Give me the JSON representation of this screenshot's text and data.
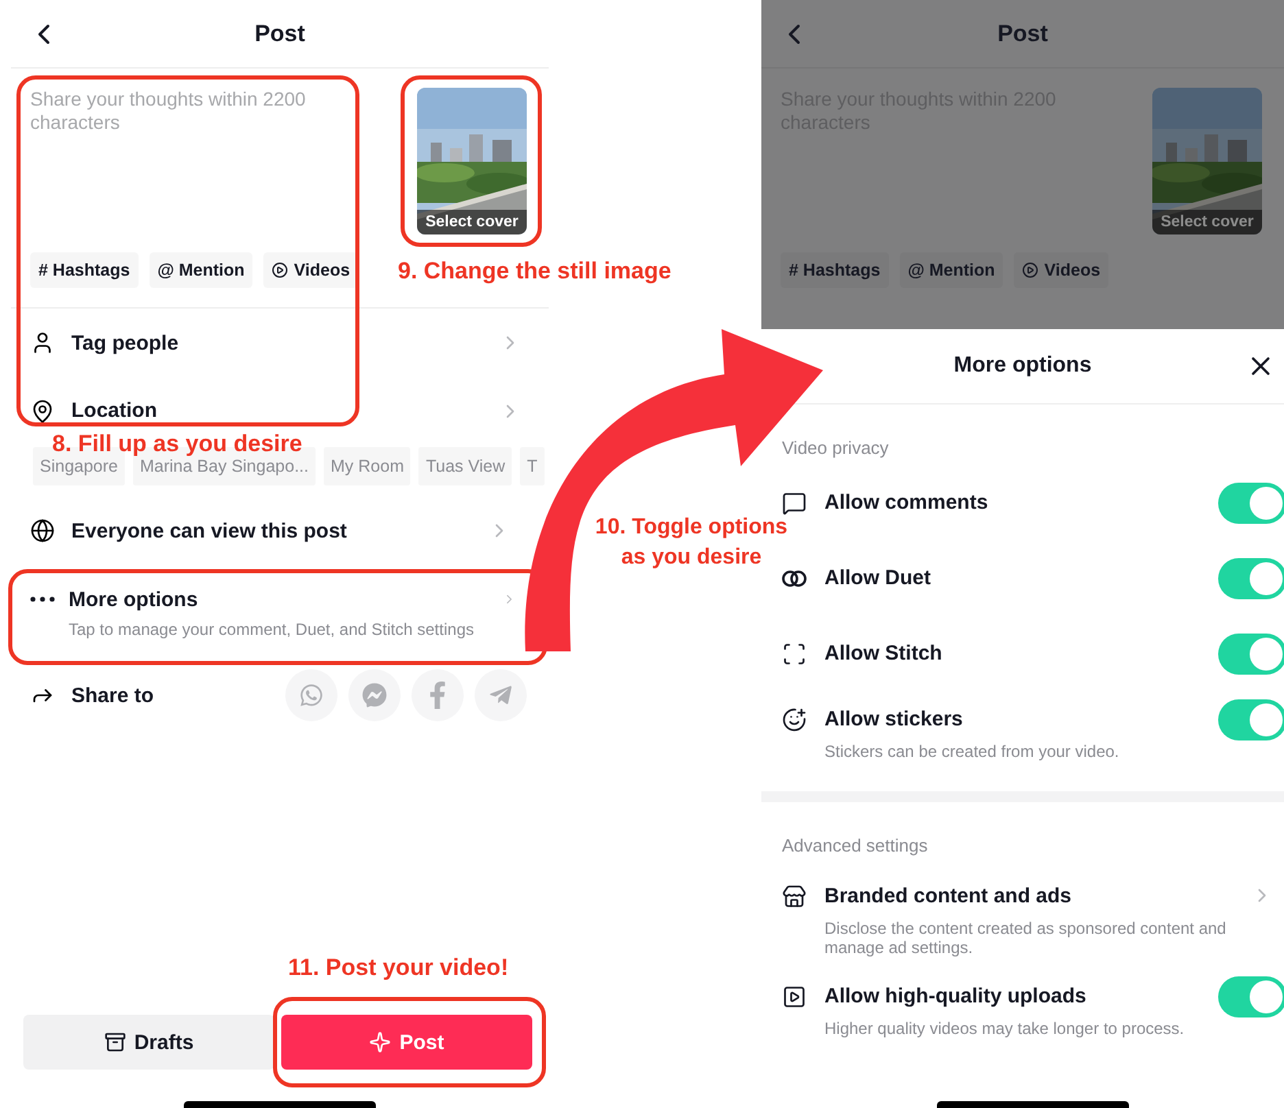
{
  "post_screen": {
    "title": "Post",
    "caption": {
      "placeholder": "Share your thoughts within 2200 characters"
    },
    "cover": {
      "label": "Select cover"
    },
    "chips": [
      {
        "label": "# Hashtags",
        "kind": "text"
      },
      {
        "label": "@ Mention",
        "kind": "text"
      },
      {
        "label": "Videos",
        "kind": "video"
      }
    ],
    "rows": [
      {
        "label": "Tag people",
        "kind": "person"
      },
      {
        "label": "Location",
        "kind": "location"
      }
    ],
    "location_suggestions": [
      "Singapore",
      "Marina Bay Singapo...",
      "My Room",
      "Tuas View",
      "T"
    ],
    "privacy": {
      "label": "Everyone can view this post"
    },
    "more_options": {
      "title": "More options",
      "subtitle": "Tap to manage your comment, Duet, and Stitch settings"
    },
    "share": {
      "label": "Share to"
    },
    "buttons": [
      {
        "label": "Drafts",
        "kind": "secondary"
      },
      {
        "label": "Post",
        "kind": "primary"
      }
    ]
  },
  "options_screen": {
    "title": "Post",
    "caption": {
      "placeholder": "Share your thoughts within 2200 characters"
    },
    "cover": {
      "label": "Select cover"
    },
    "chips": [
      {
        "label": "# Hashtags",
        "kind": "text"
      },
      {
        "label": "@ Mention",
        "kind": "text"
      },
      {
        "label": "Videos",
        "kind": "video"
      }
    ],
    "sheet": {
      "title": "More options",
      "sections": [
        {
          "title": "Video privacy",
          "items": [
            {
              "label": "Allow comments",
              "kind": "toggle",
              "on": true
            },
            {
              "label": "Allow Duet",
              "kind": "toggle",
              "on": true
            },
            {
              "label": "Allow Stitch",
              "kind": "toggle",
              "on": true
            },
            {
              "label": "Allow stickers",
              "kind": "toggle",
              "on": true,
              "subtitle": "Stickers can be created from your video."
            }
          ]
        },
        {
          "title": "Advanced settings",
          "items": [
            {
              "label": "Branded content and ads",
              "kind": "link",
              "subtitle": "Disclose the content created as sponsored content and manage ad settings."
            },
            {
              "label": "Allow high-quality uploads",
              "kind": "toggle",
              "on": true,
              "subtitle": "Higher quality videos may take longer to process."
            }
          ]
        }
      ]
    }
  },
  "annotations": [
    {
      "text": "8. Fill up as you desire"
    },
    {
      "text": "9. Change the still image"
    },
    {
      "text": "10. Toggle options as you desire"
    },
    {
      "text": "11. Post your video!"
    }
  ]
}
